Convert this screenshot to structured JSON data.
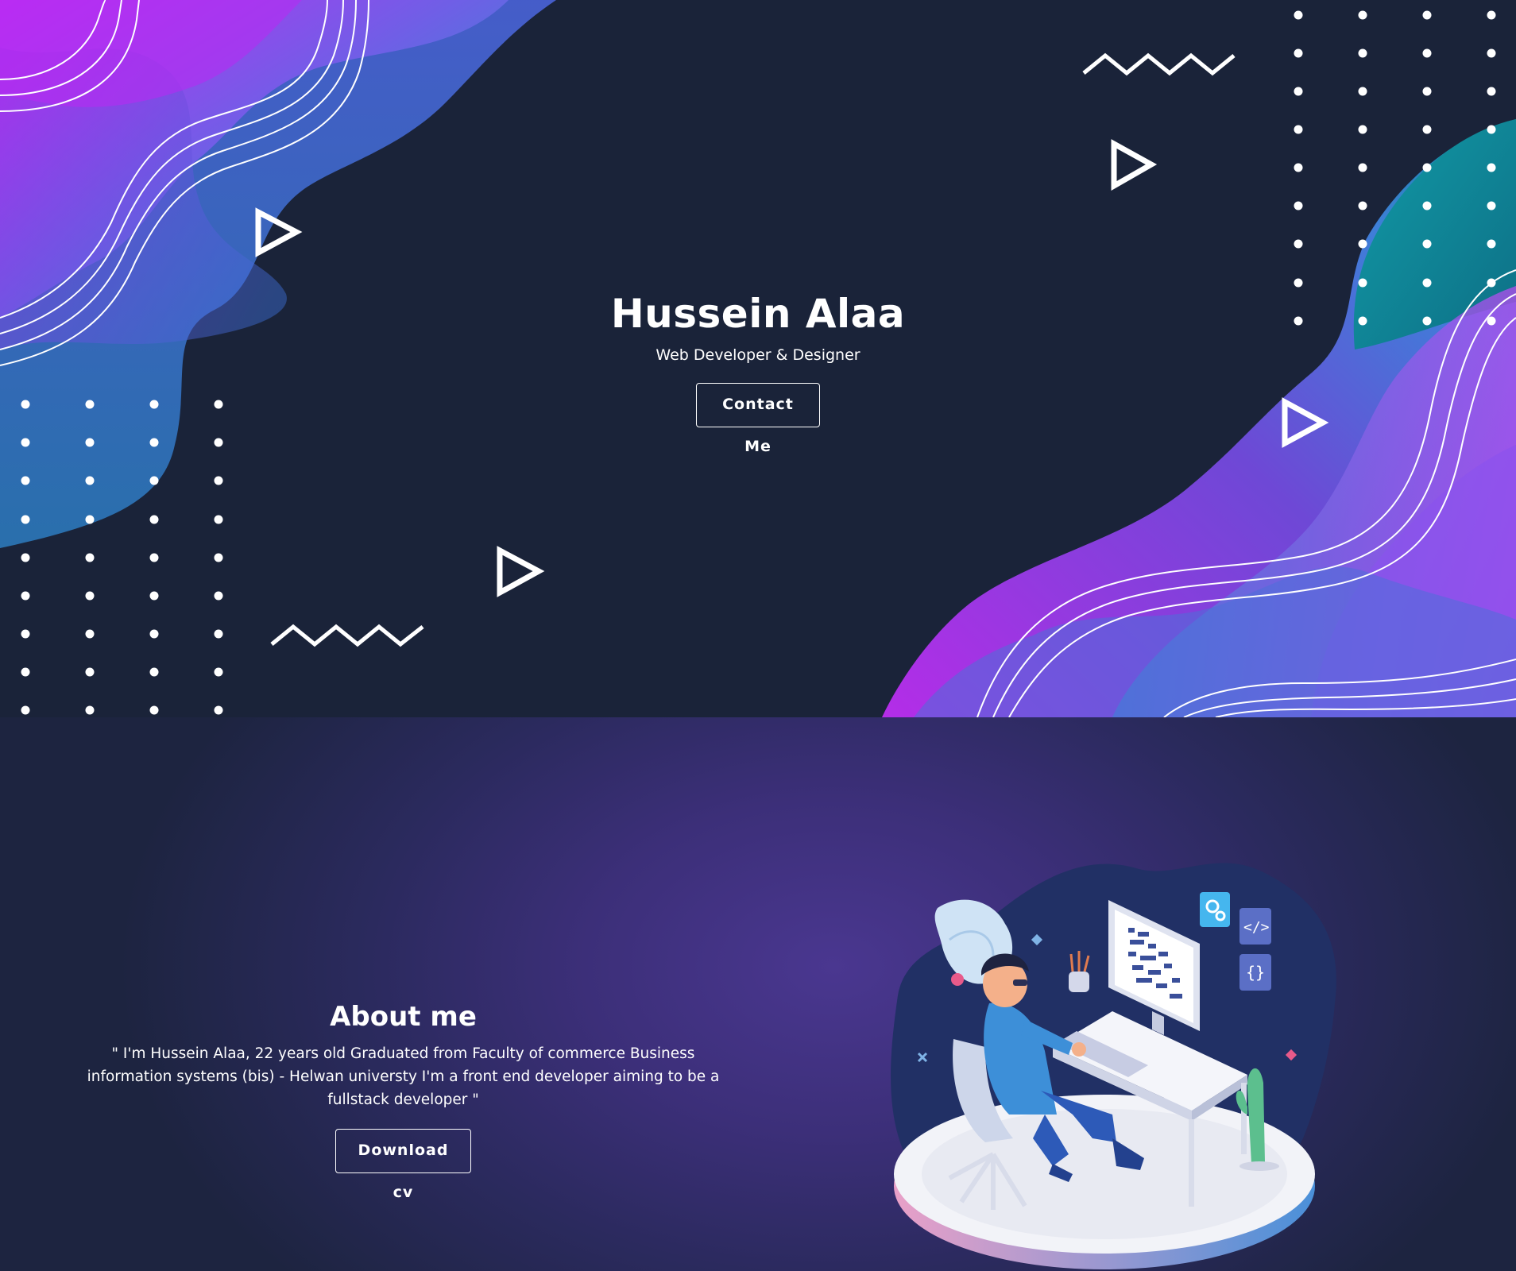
{
  "hero": {
    "name": "Hussein Alaa",
    "tagline": "Web Developer & Designer",
    "contact_button": "Contact Me"
  },
  "about": {
    "title": "About me",
    "body": "\" I'm Hussein Alaa, 22 years old Graduated from Faculty of commerce Business information systems (bis) - Helwan universty I'm a front end developer aiming to be a fullstack developer \"",
    "download_button": "Download cv"
  },
  "theme": {
    "hero_background": "#1a2339",
    "accent_purple": "#b23cf2",
    "accent_blue": "#3a90d8",
    "accent_teal": "#129aa6"
  }
}
